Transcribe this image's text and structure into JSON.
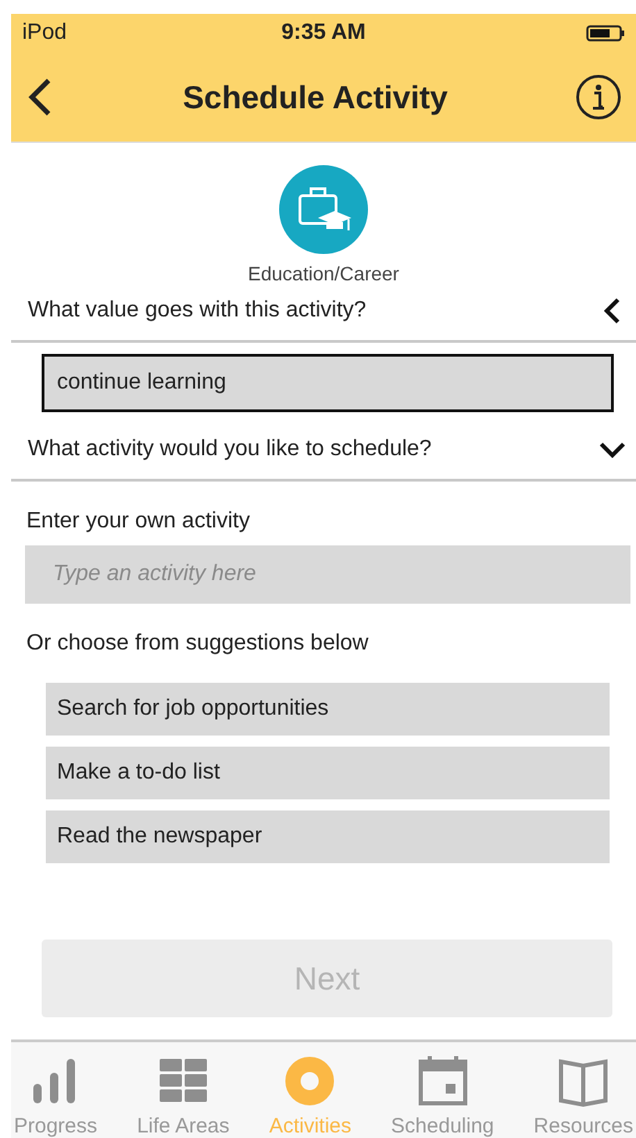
{
  "status_bar": {
    "carrier": "iPod",
    "time": "9:35 AM"
  },
  "nav": {
    "title": "Schedule Activity"
  },
  "category": {
    "label": "Education/Career"
  },
  "value_section": {
    "question": "What value goes with this activity?",
    "expanded": false,
    "value": "continue learning"
  },
  "activity_section": {
    "question": "What activity would you like to schedule?",
    "expanded": true
  },
  "own_activity": {
    "label": "Enter your own activity",
    "placeholder": "Type an activity here"
  },
  "suggestions": {
    "label": "Or choose from suggestions below",
    "items": [
      "Search for job opportunities",
      "Make a to-do list",
      "Read the newspaper"
    ]
  },
  "next_button": {
    "label": "Next",
    "disabled": true
  },
  "tabs": [
    {
      "label": "Progress",
      "kind": "chart",
      "selected": false
    },
    {
      "label": "Life Areas",
      "kind": "grid",
      "selected": false
    },
    {
      "label": "Activities",
      "kind": "ring",
      "selected": true
    },
    {
      "label": "Scheduling",
      "kind": "calendar",
      "selected": false
    },
    {
      "label": "Resources",
      "kind": "book",
      "selected": false
    }
  ]
}
